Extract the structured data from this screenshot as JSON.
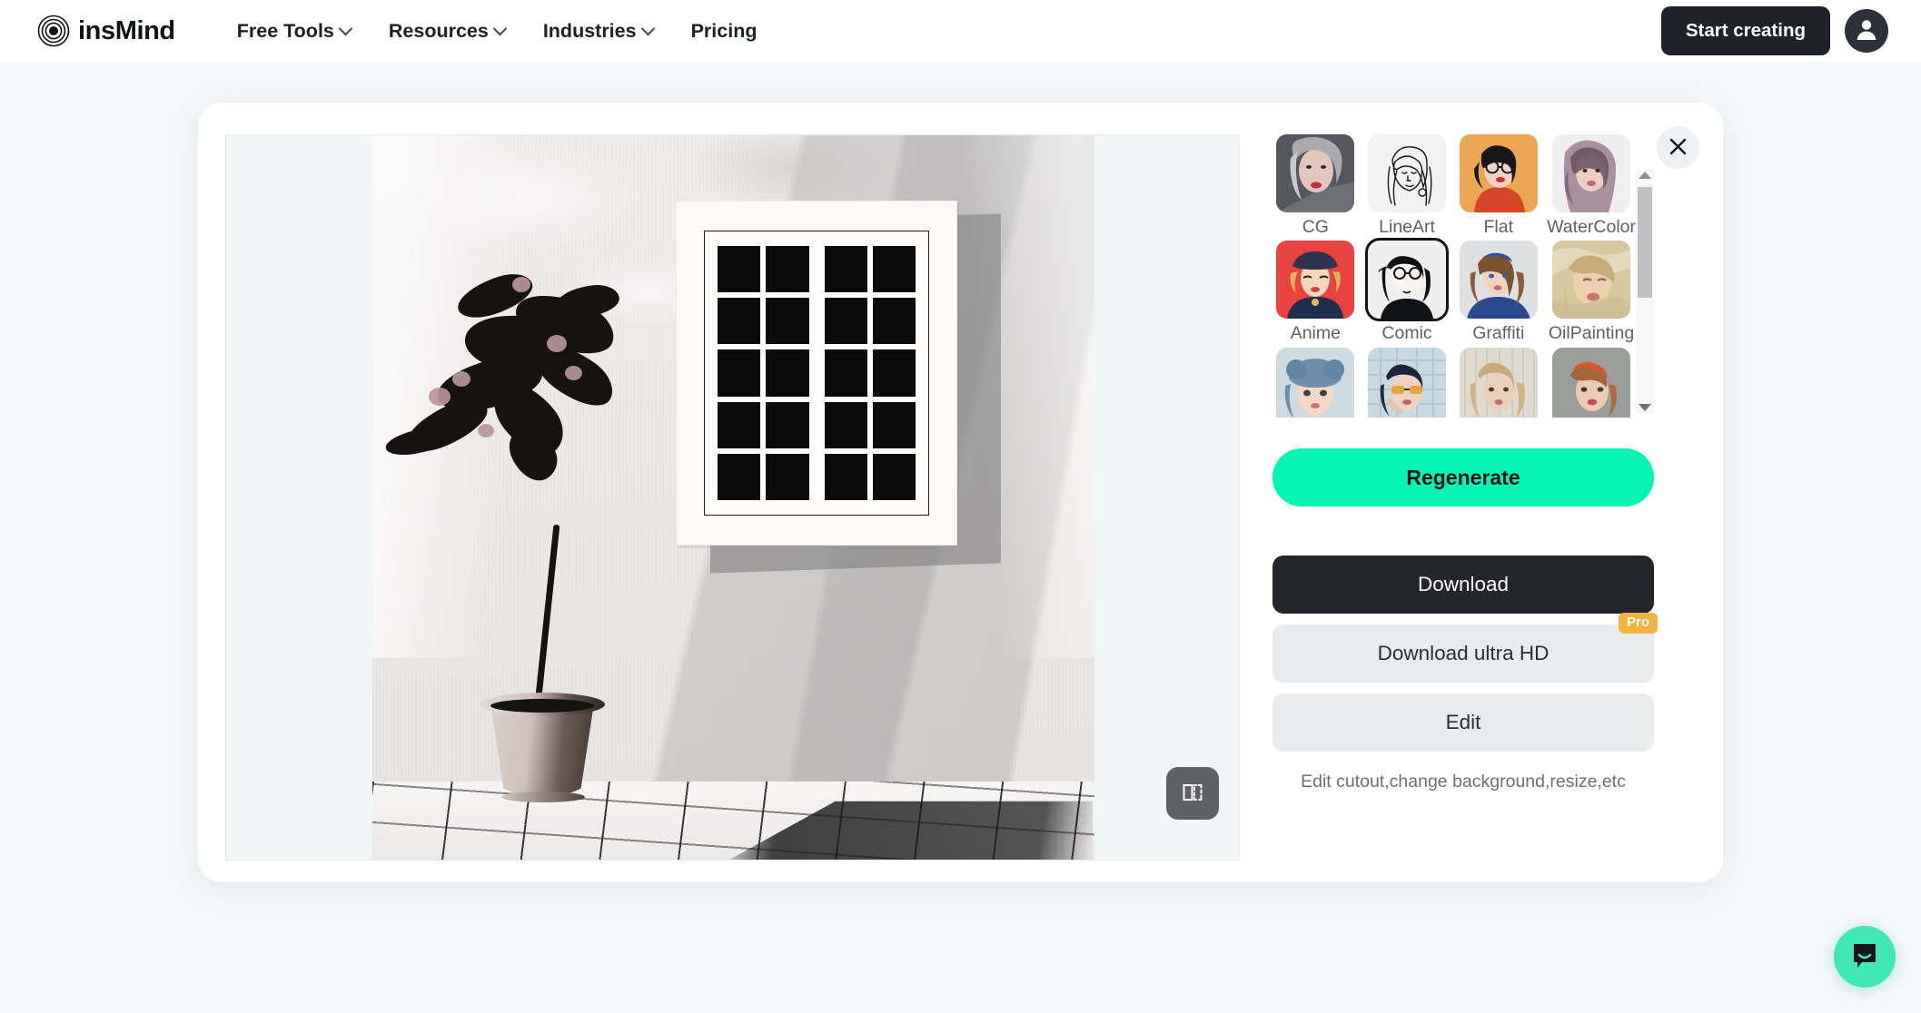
{
  "header": {
    "logo_text": "insMind",
    "logo_icon": "concentric-circles-logo",
    "nav": [
      {
        "label": "Free Tools",
        "has_dropdown": true
      },
      {
        "label": "Resources",
        "has_dropdown": true
      },
      {
        "label": "Industries",
        "has_dropdown": true
      },
      {
        "label": "Pricing",
        "has_dropdown": false
      }
    ],
    "cta_label": "Start creating",
    "avatar_icon": "user-avatar-icon"
  },
  "modal": {
    "close_icon": "close-icon",
    "canvas": {
      "compare_icon": "compare-before-after-icon",
      "artwork_alt": "comic-style illustration of a potted plant beside a white window"
    }
  },
  "styles": {
    "items": [
      {
        "label": "CG",
        "selected": false
      },
      {
        "label": "LineArt",
        "selected": false
      },
      {
        "label": "Flat",
        "selected": false
      },
      {
        "label": "WaterColor",
        "selected": false
      },
      {
        "label": "Anime",
        "selected": false
      },
      {
        "label": "Comic",
        "selected": true
      },
      {
        "label": "Graffiti",
        "selected": false
      },
      {
        "label": "OilPainting",
        "selected": false
      },
      {
        "label": "",
        "selected": false
      },
      {
        "label": "",
        "selected": false
      },
      {
        "label": "",
        "selected": false
      },
      {
        "label": "",
        "selected": false
      }
    ],
    "scroll_up_icon": "scroll-up-arrow-icon",
    "scroll_down_icon": "scroll-down-arrow-icon"
  },
  "actions": {
    "regenerate_label": "Regenerate",
    "download_label": "Download",
    "download_ultra_hd_label": "Download ultra HD",
    "pro_badge_label": "Pro",
    "edit_label": "Edit",
    "edit_hint": "Edit cutout,change background,resize,etc"
  },
  "chat": {
    "icon": "chat-bubble-smile-icon"
  },
  "colors": {
    "accent_mint": "#02f5b2",
    "dark": "#24262b",
    "pro_gold": "#f0b43f",
    "chat_teal": "#41e8b6",
    "page_bg": "#f4f6f7"
  }
}
